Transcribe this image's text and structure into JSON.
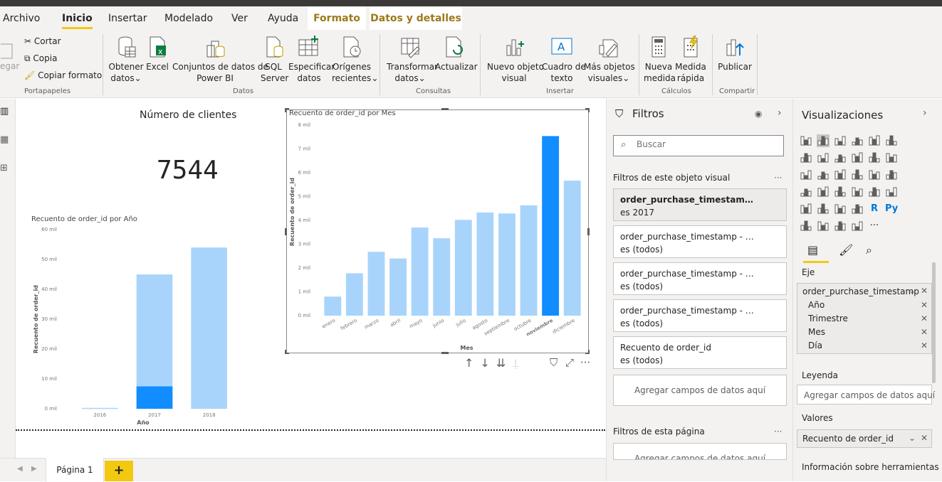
{
  "tabs": {
    "file": "Archivo",
    "home": "Inicio",
    "insert": "Insertar",
    "model": "Modelado",
    "view": "Ver",
    "help": "Ayuda",
    "format": "Formato",
    "data": "Datos y detalles"
  },
  "ribbon": {
    "clipboard": {
      "paste": "egar",
      "cut": "Cortar",
      "copy": "Copia",
      "format_painter": "Copiar formato",
      "group": "Portapapeles"
    },
    "data": {
      "get_data": "Obtener",
      "get_data2": "datos",
      "excel": "Excel",
      "datasets": "Conjuntos de datos de",
      "datasets2": "Power BI",
      "sql": "SQL",
      "sql2": "Server",
      "enter": "Especificar",
      "enter2": "datos",
      "recent": "Orígenes",
      "recent2": "recientes",
      "group": "Datos"
    },
    "queries": {
      "transform": "Transformar",
      "transform2": "datos",
      "refresh": "Actualizar",
      "group": "Consultas"
    },
    "insert": {
      "new_visual": "Nuevo objeto",
      "new_visual2": "visual",
      "textbox": "Cuadro de",
      "textbox2": "texto",
      "more": "Más objetos",
      "more2": "visuales",
      "group": "Insertar"
    },
    "calc": {
      "new_measure": "Nueva",
      "new_measure2": "medida",
      "quick": "Medida",
      "quick2": "rápida",
      "group": "Cálculos"
    },
    "share": {
      "publish": "Publicar",
      "group": "Compartir"
    }
  },
  "card": {
    "title": "Número de clientes",
    "value": "7544"
  },
  "chart_data": [
    {
      "type": "bar",
      "title": "Recuento de order_id por Año",
      "xlabel": "Año",
      "ylabel": "Recuento de order_id",
      "categories": [
        "2016",
        "2017",
        "2018"
      ],
      "values": [
        300,
        45000,
        54000
      ],
      "highlighted": [
        0,
        7500,
        0
      ],
      "ylim": [
        0,
        60000
      ],
      "yticks": [
        "0 mil",
        "10 mil",
        "20 mil",
        "30 mil",
        "40 mil",
        "50 mil",
        "60 mil"
      ],
      "colors": {
        "base": "#a8d4fb",
        "highlight": "#118dff"
      }
    },
    {
      "type": "bar",
      "title": "Recuento de order_id por Mes",
      "xlabel": "Mes",
      "ylabel": "Recuento de order_id",
      "categories": [
        "enero",
        "febrero",
        "marzo",
        "abril",
        "mayo",
        "junio",
        "julio",
        "agosto",
        "septiembre",
        "octubre",
        "noviembre",
        "diciembre"
      ],
      "values": [
        800,
        1780,
        2680,
        2400,
        3700,
        3250,
        4020,
        4330,
        4290,
        4630,
        7540,
        5670
      ],
      "selected": "noviembre",
      "ylim": [
        0,
        8000
      ],
      "yticks": [
        "0 mil",
        "1 mil",
        "2 mil",
        "3 mil",
        "4 mil",
        "5 mil",
        "6 mil",
        "7 mil",
        "8 mil"
      ],
      "colors": {
        "base": "#a8d4fb",
        "highlight": "#118dff"
      }
    }
  ],
  "filters": {
    "title": "Filtros",
    "search_placeholder": "Buscar",
    "visual_section": "Filtros de este objeto visual",
    "cards": [
      {
        "field": "order_purchase_timestamp - A...",
        "value": "es 2017"
      },
      {
        "field": "order_purchase_timestamp - Día",
        "value": "es (todos)"
      },
      {
        "field": "order_purchase_timestamp - Mes",
        "value": "es (todos)"
      },
      {
        "field": "order_purchase_timestamp - Trim...",
        "value": "es (todos)"
      },
      {
        "field": "Recuento de order_id",
        "value": "es (todos)"
      }
    ],
    "add_fields": "Agregar campos de datos aquí",
    "page_section": "Filtros de esta página",
    "page_add": "Agregar campos de datos aquí"
  },
  "viz": {
    "title": "Visualizaciones",
    "axis_label": "Eje",
    "axis_field": "order_purchase_timestamp",
    "axis_items": [
      "Año",
      "Trimestre",
      "Mes",
      "Día"
    ],
    "legend_label": "Leyenda",
    "legend_add": "Agregar campos de datos aquí",
    "values_label": "Valores",
    "values_field": "Recuento de order_id",
    "tooltips_label": "Información sobre herramientas",
    "r_label": "R",
    "py_label": "Py"
  },
  "pages": {
    "page1": "Página 1",
    "add": "+"
  },
  "ui": {
    "dots": "···"
  }
}
